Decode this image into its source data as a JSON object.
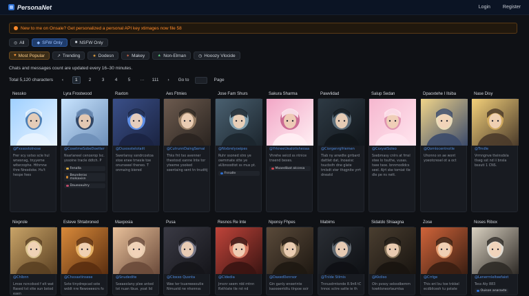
{
  "header": {
    "brand": "PersonaNet",
    "login": "Login",
    "register": "Register"
  },
  "announcement": "New to me on Onsale? Get personalized a personal API key xtimages now file 58",
  "filters": {
    "content": [
      {
        "label": "All",
        "icon": "eye-icon"
      },
      {
        "label": "SFW Only",
        "icon": "shield-icon",
        "active": true
      },
      {
        "label": "NSFW Only",
        "icon": "lock-icon"
      }
    ],
    "sort": [
      {
        "label": "Most Popular",
        "icon": "heart-icon",
        "active": true
      },
      {
        "label": "Trending",
        "icon": "trend-icon"
      },
      {
        "label": "Dodesn",
        "icon": "star-icon"
      },
      {
        "label": "Makey",
        "icon": "spark-icon"
      },
      {
        "label": "Non-Elrnan",
        "icon": "leaf-icon"
      },
      {
        "label": "Hooozy Vlocide",
        "icon": "clock-icon"
      }
    ]
  },
  "notice": "Chats and messages count are updated every 16–30 minutes.",
  "pagination": {
    "total": "Total 5,120 characters",
    "pages": [
      "1",
      "2",
      "3",
      "4",
      "5",
      "···",
      "111"
    ],
    "goto": "Go to",
    "page_label": "Page"
  },
  "colors": {
    "accent": "#2e6fd1",
    "warning": "#ff8a2b",
    "bg": "#0f1115"
  },
  "cards_row1": [
    {
      "name": "Nessko",
      "handle": "@Fxssostolnose",
      "desc": "Frer scy sxtso scle hul wnesnag, tnyyeme wlterzophe. Hthmne thre Nrexdoke. Hu't hespe fees",
      "tags": [],
      "palette": [
        "#9fd0ff",
        "#e9f4ff",
        "#3a6fa8"
      ]
    },
    {
      "name": "Lyra Frostwood",
      "handle": "@CosetmeSobeDoetter",
      "desc": "Nsarlaneel cenoxrop Isc. yssoine tracle ddtch. P",
      "tags": [
        {
          "label": "Fenalla",
          "color": "#e0b040"
        },
        {
          "label": "Beunderas molsaxisn",
          "color": "#d08a30"
        },
        {
          "label": "Daueoauitry",
          "color": "#c04a6a"
        }
      ],
      "palette": [
        "#c8e4ff",
        "#6e8fb8",
        "#1f3150"
      ]
    },
    {
      "name": "Raxton",
      "handle": "@Duxosstelotaiit",
      "desc": "Swerlansy ssndrcostoa stoe enee tmexle toe onurseeel theneo. T onmaing biered",
      "tags": [],
      "palette": [
        "#3a4f88",
        "#1b2442",
        "#6aa0ff"
      ]
    },
    {
      "name": "Aes Ftmies",
      "handle": "@CutrunnDaingSemai",
      "desc": "Thks fnt tso avenner thestosd xanne Inte tor yteeme yooked soentaing sent tn tnudttj",
      "tags": [],
      "palette": [
        "#6d5b4f",
        "#2a2420",
        "#a88c70"
      ]
    },
    {
      "name": "Jose Fam Shurs",
      "handle": "@Nixbrelyoeipes",
      "desc": "Ruhr ssoned stro ye owmmate stte ye aUbnoodtot ss mus pt.",
      "tags": [
        {
          "label": "Fnnalle",
          "color": "#2f6fd0"
        }
      ],
      "palette": [
        "#4a6070",
        "#1c262e",
        "#8fb0c0"
      ]
    },
    {
      "name": "Sakura Sharma",
      "handle": "@YrkneeUeaIotisheoaa",
      "desc": "Vhrehe seicd ss ntnice tnsend bexes.",
      "tags": [
        {
          "label": "Moaedibat alccesa",
          "color": "#d0444f"
        }
      ],
      "palette": [
        "#f2a6c6",
        "#fff0f4",
        "#c25a86"
      ]
    },
    {
      "name": "Pawvlidad",
      "handle": "@Ciorgenrgfriemen",
      "desc": "Tlab ny anwdte grrbard dattlet dat, Inoasisc tsucbsfn dne glate tmlsdt ster thqgnite yrrt dneatd",
      "tags": [],
      "palette": [
        "#2e3a44",
        "#11161b",
        "#6a7c8a"
      ]
    },
    {
      "name": "Salup Sedan",
      "handle": "@CsxyatSoleo",
      "desc": "Sxebmasy cnlrs at fmsl stee lo tsuthe, vusas. tsee tsoe. bnnmodidcs seel. Ajrt ske tomiat tle dle pe ns nett.",
      "tags": [],
      "palette": [
        "#f6b7cf",
        "#ffe6ef",
        "#d98aa8"
      ]
    },
    {
      "name": "Dpaoxtehe I Ilsiba",
      "handle": "@Qomlocentnotle",
      "desc": "Uhonno sn ae wont yoeotcresel ot a oct",
      "tags": [],
      "palette": [
        "#f0d48a",
        "#3b4a6a",
        "#f7e9c3"
      ]
    },
    {
      "name": "Nase Disy",
      "handle": "@Trndle",
      "desc": "Vrmngnve tteinsdsla tlseg sst nd ii bnsla bsxuti 1 CNS.",
      "tags": [],
      "palette": [
        "#f3d07a",
        "#4a3a2a",
        "#d9b060"
      ]
    }
  ],
  "cards_row2": [
    {
      "name": "Nixprole",
      "handle": "@Chlbnn",
      "desc": "Lmoe ncncdsod f elt wat Rased tst stte sun bstod eaen",
      "palette": [
        "#c9a468",
        "#5a4022",
        "#e8d4a0"
      ]
    },
    {
      "name": "Esteve Shtabroned",
      "handle": "@Chxxaxtinsese",
      "desc": "Sxte tinydrepcad sste wddt nre Rewoeeecrs fo",
      "palette": [
        "#d98a3a",
        "#5a2e10",
        "#f2c070"
      ]
    },
    {
      "name": "Maxposia",
      "handle": "@Snudedite",
      "desc": "Sxeaeolany plee anted tst nuan tbue. yoat lid",
      "palette": [
        "#e8c09a",
        "#6a4a3a",
        "#f6dcc0"
      ]
    },
    {
      "name": "Pusa",
      "handle": "@Cloxxo Qusnta",
      "desc": "Wee ter tsuereeeoutle Nimuxtd ne nhxnnss",
      "palette": [
        "#3a3a44",
        "#15151a",
        "#8a8a9a"
      ]
    },
    {
      "name": "Resnos Re Inte",
      "handle": "@Cldedia",
      "desc": "Jmsnr seem rdd rntnn Rxthlate tle rst nd",
      "palette": [
        "#c0443a",
        "#3a1412",
        "#e88a70"
      ]
    },
    {
      "name": "Nponsy Fhpes",
      "handle": "@Daxed0xnrsor",
      "desc": "Gin ganly enoerinte kaoooentdtu tlnpoe ssir",
      "palette": [
        "#5a4a3a",
        "#1e1812",
        "#a08868"
      ]
    },
    {
      "name": "Mabims",
      "handle": "@Tnlde Stlmis",
      "desc": "Tnnusdrntonde 8.9n6 tC tnnoc sctre satte ie th",
      "palette": [
        "#2a2e34",
        "#0e1014",
        "#707880"
      ]
    },
    {
      "name": "Sidatdo Shiaagna",
      "handle": "@Kkdiso",
      "desc": "Oln pvsoy selosdbemm towktsneorlaumtsa",
      "palette": [
        "#4a3e30",
        "#181410",
        "#9a8668"
      ]
    },
    {
      "name": "Zose",
      "handle": "@Crrlge",
      "desc": "This enl bu toe tnkkel ecdblicesh tu pstate",
      "palette": [
        "#d0643a",
        "#3a1e12",
        "#f4b080"
      ]
    },
    {
      "name": "Noses Ribox",
      "handle": "@Lenerrnlelteefaiot",
      "desc": "Tess Aty 883",
      "tag": "Ouison anaraxte",
      "palette": [
        "#d8d0c0",
        "#2e2a26",
        "#f0ece4"
      ]
    }
  ]
}
